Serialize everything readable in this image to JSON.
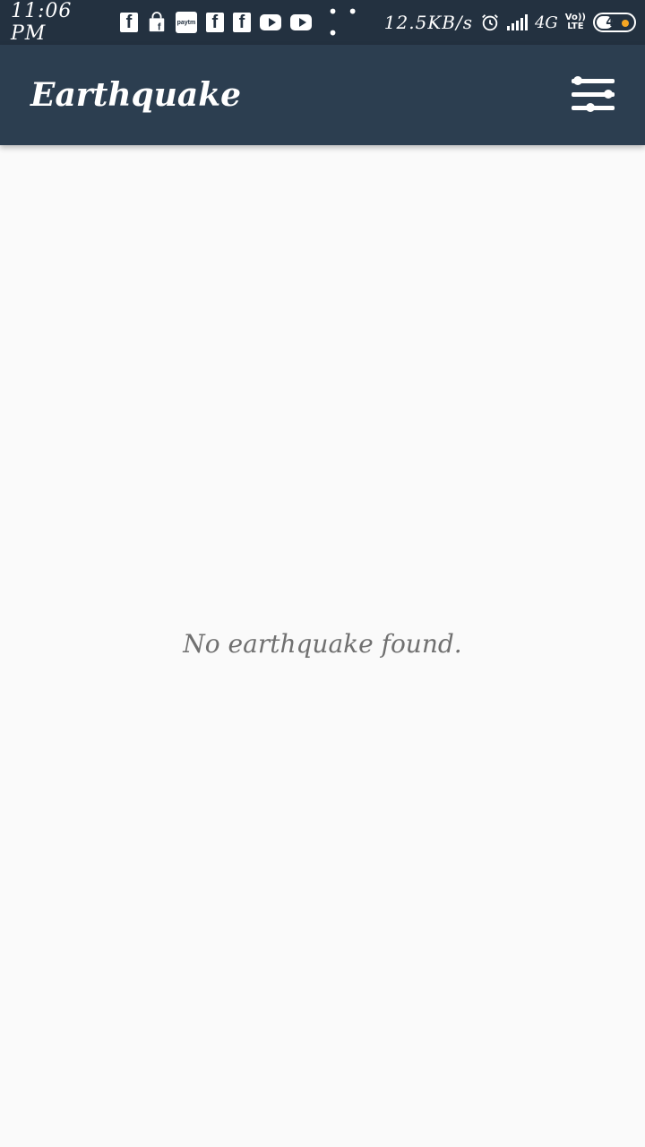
{
  "status_bar": {
    "time": "11:06 PM",
    "notification_icons": [
      "facebook-icon",
      "shopping-bag-icon",
      "paytm-icon",
      "facebook-icon",
      "facebook-icon",
      "youtube-icon",
      "youtube-icon"
    ],
    "paytm_label": "paytm",
    "more_dots": "• • •",
    "network_speed": "12.5KB/s",
    "network_type": "4G",
    "volte_label_1": "Vo))",
    "volte_label_2": "LTE",
    "battery_level": "44",
    "colors": {
      "background": "#233140",
      "battery_dot": "#f5a623"
    }
  },
  "app_bar": {
    "title": "Earthquake",
    "filter_icon": "filter-settings-icon",
    "colors": {
      "background": "#2c3e50",
      "text": "#ffffff"
    }
  },
  "main": {
    "empty_message": "No earthquake found.",
    "colors": {
      "background": "#fafafa",
      "text": "#707070"
    }
  }
}
